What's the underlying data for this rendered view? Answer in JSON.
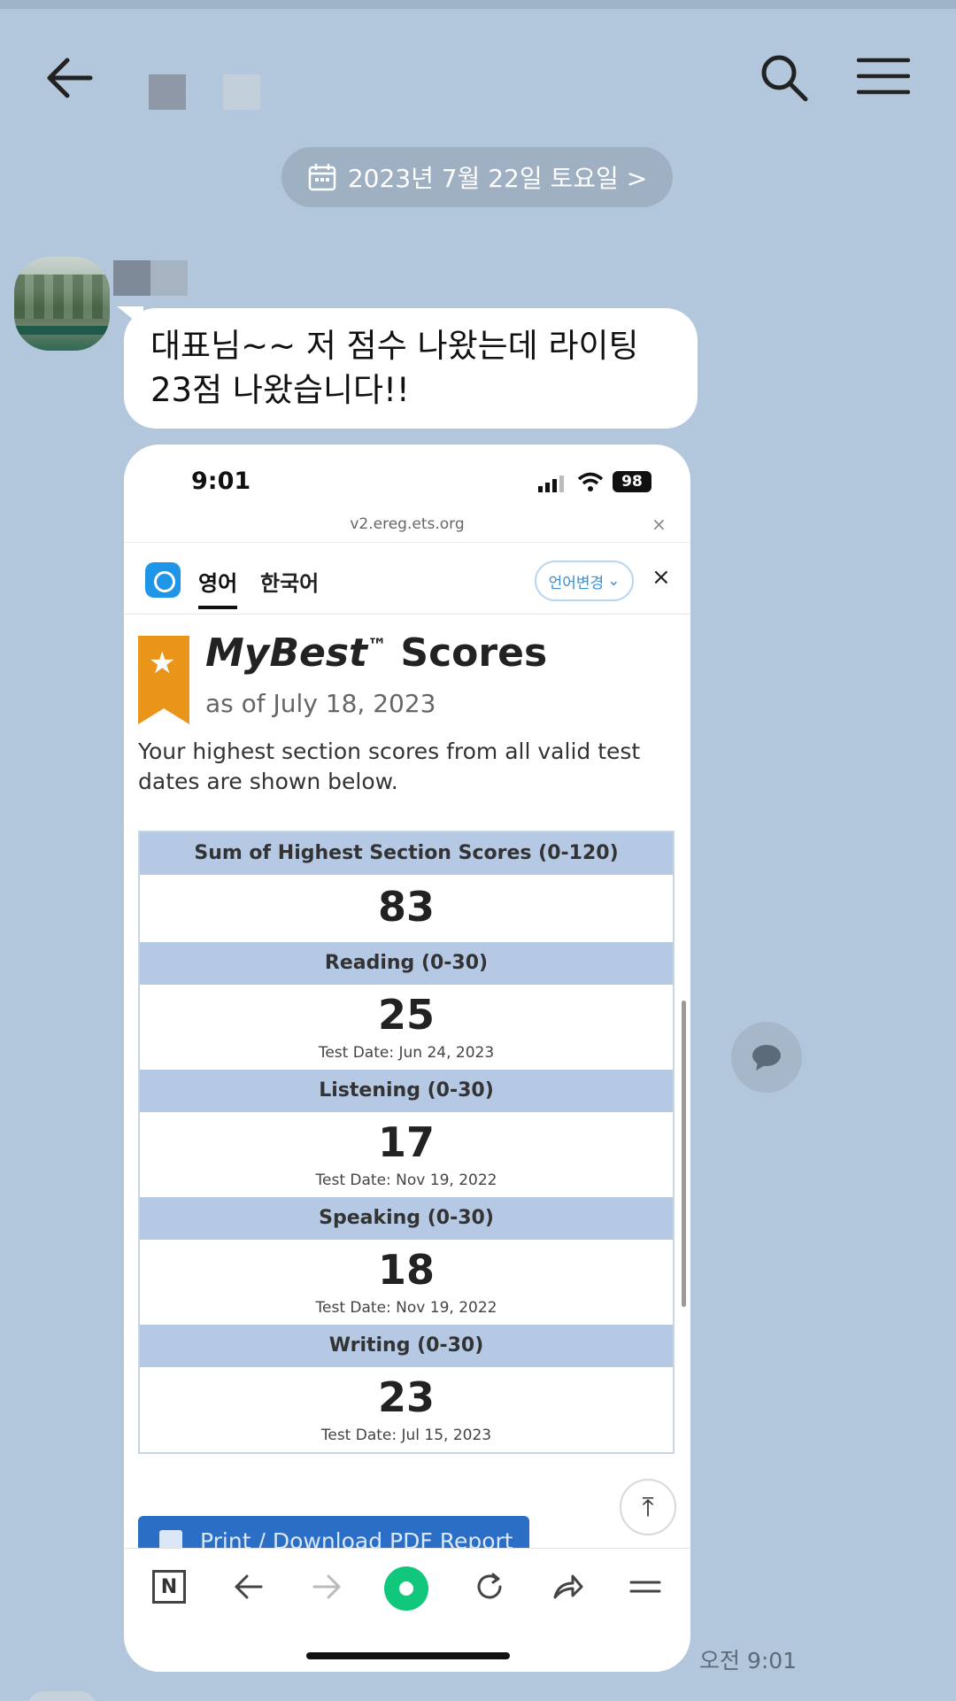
{
  "chat": {
    "date": "2023년 7월 22일 토요일 >",
    "message": "대표님~~ 저 점수 나왔는데 라이팅\n23점 나왔습니다!!",
    "timestamp": "오전 9:01"
  },
  "screenshot": {
    "status_time": "9:01",
    "battery": "98",
    "url": "v2.ereg.ets.org",
    "url_close": "×",
    "tabs": [
      "영어",
      "한국어"
    ],
    "lang_button": "언어변경",
    "close": "×",
    "title_brand": "MyBest",
    "title_tm": "™",
    "title_rest": " Scores",
    "as_of": "as of July 18, 2023",
    "description": "Your highest section scores from all valid test dates are shown below.",
    "sum_header": "Sum of Highest Section Scores (0-120)",
    "sum_value": "83",
    "sections": [
      {
        "name": "Reading (0-30)",
        "score": "25",
        "date": "Test Date: Jun 24, 2023"
      },
      {
        "name": "Listening (0-30)",
        "score": "17",
        "date": "Test Date: Nov 19, 2022"
      },
      {
        "name": "Speaking (0-30)",
        "score": "18",
        "date": "Test Date: Nov 19, 2022"
      },
      {
        "name": "Writing (0-30)",
        "score": "23",
        "date": "Test Date: Jul 15, 2023"
      }
    ],
    "pdf_button": "Print / Download PDF Report",
    "bottom_n": "N"
  },
  "colors": {
    "chat_bg": "#b2c7dc",
    "section_header": "#b5c9e5",
    "ribbon": "#e8951a",
    "pdf_button": "#2a6ec6",
    "home_green": "#10c77c"
  }
}
